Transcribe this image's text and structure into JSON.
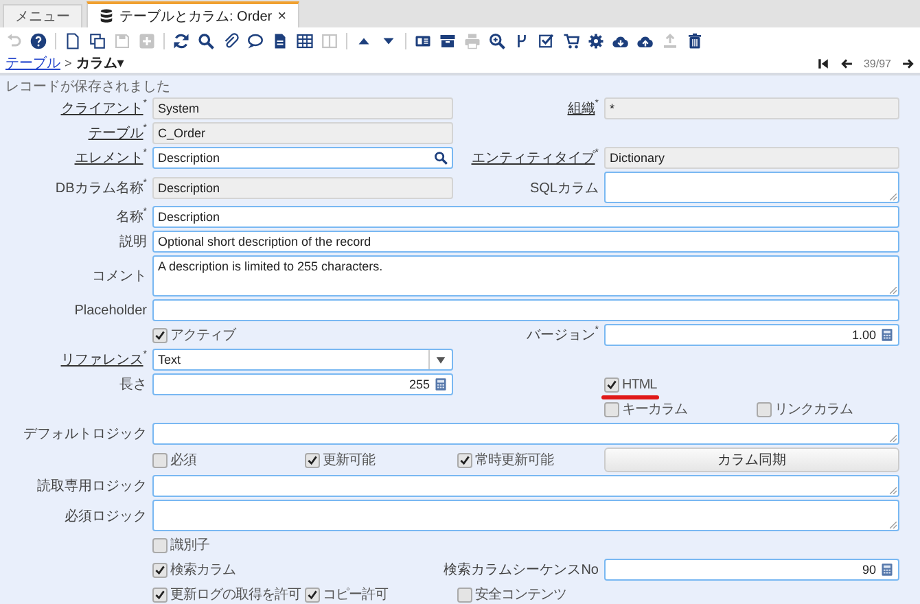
{
  "tabs": [
    {
      "label": "メニュー",
      "selected": false,
      "icon": false
    },
    {
      "label": "テーブルとカラム: Order",
      "selected": true,
      "icon": true,
      "close": "×"
    }
  ],
  "toolbar": [
    {
      "kind": "button",
      "disabled": true
    },
    {
      "kind": "button",
      "disabled": false
    },
    {
      "kind": "separator"
    },
    {
      "kind": "button",
      "disabled": false
    },
    {
      "kind": "button",
      "disabled": false
    },
    {
      "kind": "button",
      "disabled": true
    },
    {
      "kind": "button",
      "disabled": true
    },
    {
      "kind": "separator"
    },
    {
      "kind": "button",
      "disabled": false
    },
    {
      "kind": "button",
      "disabled": false
    },
    {
      "kind": "button",
      "disabled": false
    },
    {
      "kind": "button",
      "disabled": false
    },
    {
      "kind": "button",
      "disabled": false
    },
    {
      "kind": "button",
      "disabled": false
    },
    {
      "kind": "button",
      "disabled": true
    },
    {
      "kind": "separator"
    },
    {
      "kind": "button",
      "disabled": false
    },
    {
      "kind": "button",
      "disabled": false
    },
    {
      "kind": "separator"
    },
    {
      "kind": "button",
      "disabled": false
    },
    {
      "kind": "button",
      "disabled": false
    },
    {
      "kind": "button",
      "disabled": true
    },
    {
      "kind": "button",
      "disabled": false
    },
    {
      "kind": "button",
      "disabled": false
    },
    {
      "kind": "button",
      "disabled": false
    },
    {
      "kind": "button",
      "disabled": false
    },
    {
      "kind": "button",
      "disabled": false
    },
    {
      "kind": "button",
      "disabled": false
    },
    {
      "kind": "button",
      "disabled": false
    },
    {
      "kind": "button",
      "disabled": true
    },
    {
      "kind": "button",
      "disabled": false
    }
  ],
  "breadcrumb": {
    "parent": "テーブル",
    "separator": ">",
    "current": "カラム",
    "caret": "▾"
  },
  "record_nav": {
    "position": "39/97"
  },
  "message": "レコードが保存されました",
  "form": {
    "rows": [
      {
        "left": [
          {
            "kind": "text",
            "label": "クライアント",
            "link": true,
            "mark": "*",
            "value": "System",
            "readonly": true
          }
        ],
        "right": [
          {
            "kind": "text",
            "label": "組織",
            "link": true,
            "mark": "*",
            "value": "*",
            "readonly": true
          }
        ]
      },
      {
        "left": [
          {
            "kind": "text",
            "label": "テーブル",
            "link": true,
            "mark": "*",
            "value": "C_Order",
            "readonly": true
          }
        ]
      },
      {
        "left": [
          {
            "kind": "search",
            "label": "エレメント",
            "link": true,
            "mark": "*",
            "value": "Description",
            "readonly": false
          }
        ],
        "right": [
          {
            "kind": "text",
            "label": "エンティティタイプ",
            "link": true,
            "mark": "*",
            "value": "Dictionary",
            "readonly": true
          }
        ]
      },
      {
        "left": [
          {
            "kind": "text",
            "label": "DBカラム名称",
            "link": false,
            "mark": "*",
            "value": "Description",
            "readonly": true
          }
        ],
        "right": [
          {
            "kind": "textarea",
            "label": "SQLカラム",
            "link": false
          }
        ]
      },
      {
        "full": {
          "kind": "text",
          "label": "名称",
          "link": false,
          "mark": "*",
          "value": "Description",
          "readonly": false
        }
      },
      {
        "full": {
          "kind": "text",
          "label": "説明",
          "link": false,
          "value": "Optional short description of the record",
          "readonly": false
        }
      },
      {
        "full": {
          "kind": "textarea",
          "label": "コメント",
          "link": false,
          "value": "A description is limited to 255 characters."
        }
      },
      {
        "full": {
          "kind": "text",
          "label": "Placeholder",
          "link": false,
          "readonly": false
        }
      },
      {
        "left": [
          {
            "kind": "checkbox",
            "label": "アクティブ",
            "checked": true
          }
        ],
        "right": [
          {
            "kind": "number",
            "label": "バージョン",
            "link": false,
            "mark": "*",
            "value": "1.00"
          }
        ]
      },
      {
        "left": [
          {
            "kind": "select",
            "label": "リファレンス",
            "link": true,
            "mark": "*",
            "value": "Text"
          }
        ]
      },
      {
        "left": [
          {
            "kind": "number",
            "label": "長さ",
            "link": false,
            "value": "255"
          }
        ],
        "right": [
          {
            "kind": "checkbox",
            "label": "HTML",
            "checked": true,
            "underlined": true
          }
        ]
      },
      {
        "right": [
          {
            "kind": "checkbox",
            "label": "キーカラム",
            "checked": false
          },
          {
            "kind": "checkbox",
            "label": "リンクカラム",
            "checked": false
          }
        ]
      },
      {
        "full": {
          "kind": "textarea",
          "label": "デフォルトロジック",
          "link": false
        }
      },
      {
        "left": [
          {
            "kind": "checkbox",
            "label": "必須",
            "checked": false
          },
          {
            "kind": "checkbox",
            "label": "更新可能",
            "checked": true
          },
          {
            "kind": "checkbox",
            "label": "常時更新可能",
            "checked": true
          }
        ],
        "right": [
          {
            "kind": "button",
            "label": "カラム同期"
          }
        ]
      },
      {
        "full": {
          "kind": "textarea",
          "label": "読取専用ロジック",
          "link": false
        }
      },
      {
        "full": {
          "kind": "textarea",
          "label": "必須ロジック",
          "link": false
        }
      },
      {
        "left": [
          {
            "kind": "checkbox",
            "label": "識別子",
            "checked": false
          }
        ]
      },
      {
        "left": [
          {
            "kind": "checkbox",
            "label": "検索カラム",
            "checked": true
          }
        ],
        "right": [
          {
            "kind": "number",
            "label": "検索カラムシーケンスNo",
            "link": false,
            "value": "90"
          }
        ]
      },
      {
        "left": [
          {
            "kind": "checkbox",
            "label": "更新ログの取得を許可",
            "checked": true
          },
          {
            "kind": "checkbox",
            "label": "コピー許可",
            "checked": true
          },
          {
            "kind": "checkbox",
            "label": "安全コンテンツ",
            "checked": false
          }
        ]
      }
    ]
  }
}
